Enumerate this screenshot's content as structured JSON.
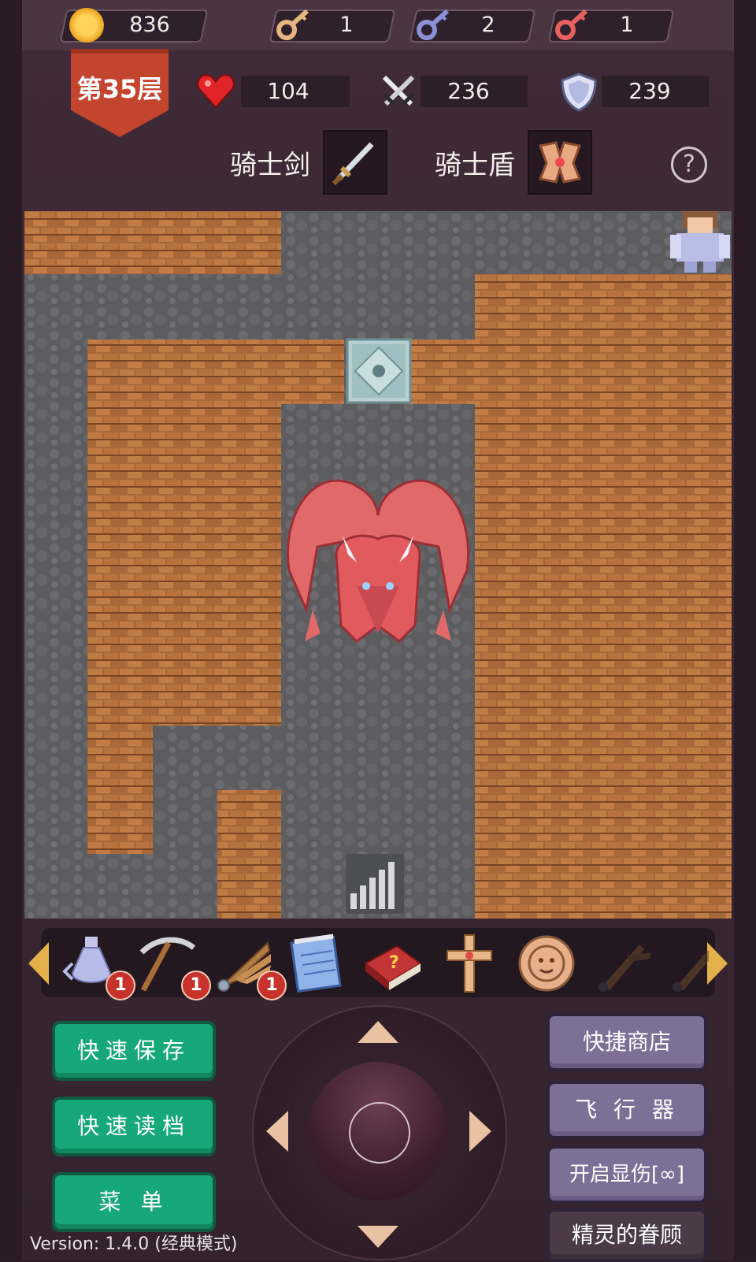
{
  "resources": {
    "gold": "836",
    "yellow_keys": "1",
    "blue_keys": "2",
    "red_keys": "1"
  },
  "floor": {
    "label": "第35层"
  },
  "stats": {
    "hp": "104",
    "attack": "236",
    "defense": "239"
  },
  "equipment": {
    "weapon_label": "骑士剑",
    "armor_label": "骑士盾"
  },
  "help_symbol": "?",
  "items": [
    {
      "icon": "holy-water-icon",
      "count": "1"
    },
    {
      "icon": "pickaxe-icon",
      "count": "1"
    },
    {
      "icon": "wing-icon",
      "count": "1"
    },
    {
      "icon": "notepad-icon",
      "count": ""
    },
    {
      "icon": "monster-book-icon",
      "count": ""
    },
    {
      "icon": "cross-icon",
      "count": ""
    },
    {
      "icon": "coin-face-icon",
      "count": ""
    },
    {
      "icon": "staff-icon",
      "count": ""
    },
    {
      "icon": "staff-icon",
      "count": ""
    }
  ],
  "buttons": {
    "quick_save": "快速保存",
    "quick_load": "快速读档",
    "menu": "菜 单",
    "quick_shop": "快捷商店",
    "fly": "飞 行 器",
    "show_damage": "开启显伤[∞]",
    "spirit_favor": "精灵的眷顾"
  },
  "version": "Version: 1.4.0 (经典模式)",
  "colors": {
    "green_button": "#17a87a",
    "purple_button": "#7e6f97",
    "wall": "#a8683a",
    "floor_tile": "#5f5f62",
    "dragon": "#e06060"
  }
}
